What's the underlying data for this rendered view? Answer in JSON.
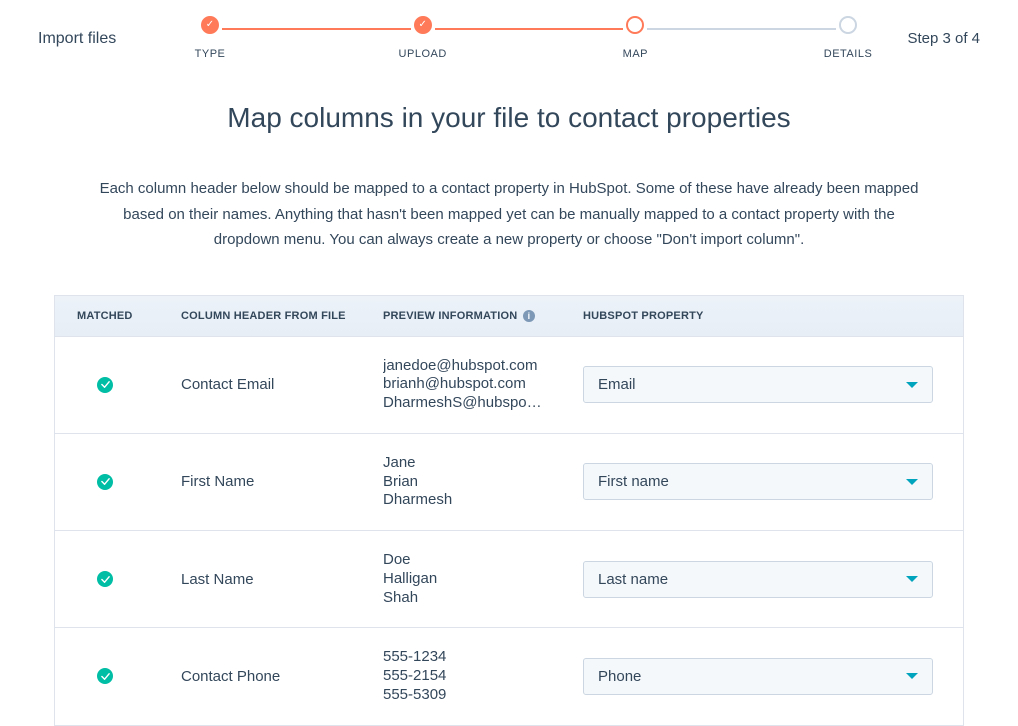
{
  "header": {
    "title": "Import files",
    "step_counter": "Step 3 of 4"
  },
  "stepper": {
    "steps": [
      {
        "label": "TYPE"
      },
      {
        "label": "UPLOAD"
      },
      {
        "label": "MAP"
      },
      {
        "label": "DETAILS"
      }
    ]
  },
  "main": {
    "title": "Map columns in your file to contact properties",
    "description": "Each column header below should be mapped to a contact property in HubSpot. Some of these have already been mapped based on their names. Anything that hasn't been mapped yet can be manually mapped to a contact property with the dropdown menu. You can always create a new property or choose \"Don't import column\"."
  },
  "table": {
    "columns": {
      "matched": "MATCHED",
      "header": "COLUMN HEADER FROM FILE",
      "preview": "PREVIEW INFORMATION",
      "property": "HUBSPOT PROPERTY"
    },
    "rows": [
      {
        "matched": true,
        "header": "Contact Email",
        "preview": [
          "janedoe@hubspot.com",
          "brianh@hubspot.com",
          "DharmeshS@hubspo…"
        ],
        "property": "Email"
      },
      {
        "matched": true,
        "header": "First Name",
        "preview": [
          "Jane",
          "Brian",
          "Dharmesh"
        ],
        "property": "First name"
      },
      {
        "matched": true,
        "header": "Last Name",
        "preview": [
          "Doe",
          "Halligan",
          "Shah"
        ],
        "property": "Last name"
      },
      {
        "matched": true,
        "header": "Contact Phone",
        "preview": [
          "555-1234",
          "555-2154",
          "555-5309"
        ],
        "property": "Phone"
      }
    ]
  }
}
